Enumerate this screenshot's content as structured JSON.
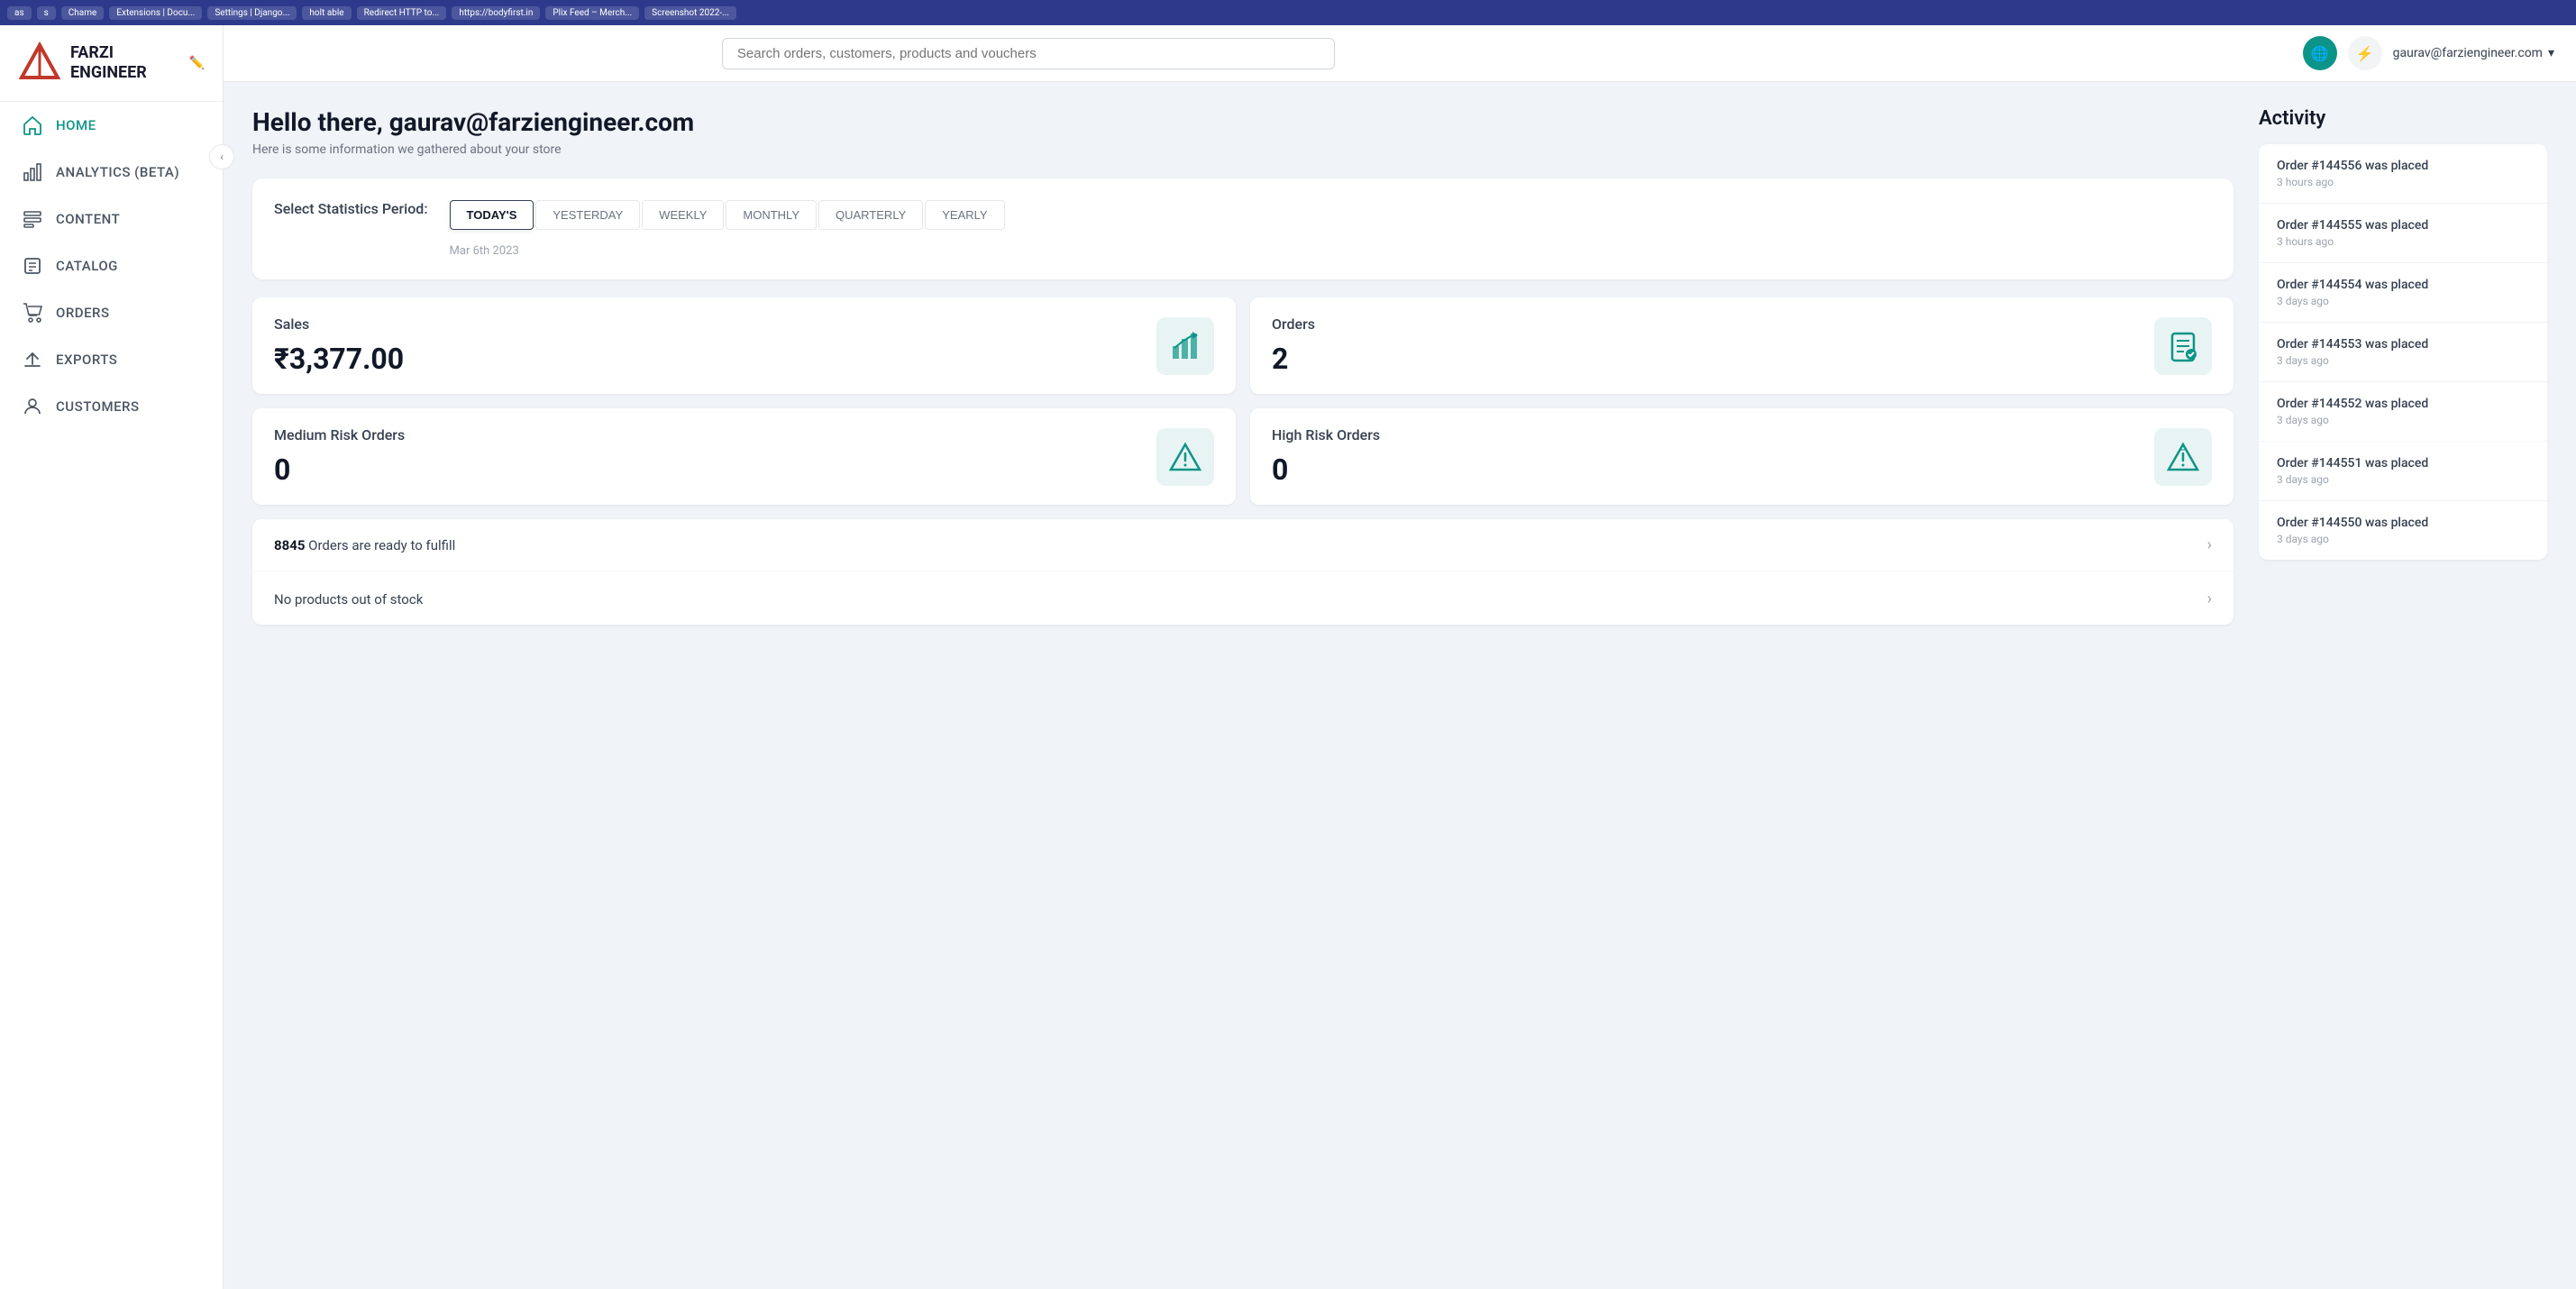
{
  "browser": {
    "tabs": [
      "as",
      "s",
      "Chame",
      "Extensions | Docu...",
      "Settings | Django...",
      "holt able",
      "Redirect HTTP to...",
      "https://bodyfirst.in",
      "Plix Feed – Merch...",
      "Screenshot 2022-..."
    ]
  },
  "sidebar": {
    "logo_line1": "FARZI",
    "logo_line2": "ENGINEER",
    "collapse_label": "‹",
    "nav_items": [
      {
        "key": "home",
        "label": "HOME",
        "active": true
      },
      {
        "key": "analytics",
        "label": "ANALYTICS (BETA)",
        "active": false
      },
      {
        "key": "content",
        "label": "CONTENT",
        "active": false
      },
      {
        "key": "catalog",
        "label": "CATALOG",
        "active": false
      },
      {
        "key": "orders",
        "label": "ORDERS",
        "active": false
      },
      {
        "key": "exports",
        "label": "EXPORTS",
        "active": false
      },
      {
        "key": "customers",
        "label": "CUSTOMERS",
        "active": false
      }
    ]
  },
  "topbar": {
    "search_placeholder": "Search orders, customers, products and vouchers",
    "user_email": "gaurav@farziengineer.com"
  },
  "page": {
    "greeting": "Hello there, gaurav@farziengineer.com",
    "subtext": "Here is some information we gathered about your store"
  },
  "stats": {
    "period_label": "Select Statistics Period:",
    "tabs": [
      "TODAY'S",
      "YESTERDAY",
      "WEEKLY",
      "MONTHLY",
      "QUARTERLY",
      "YEARLY"
    ],
    "active_tab": "TODAY'S",
    "date": "Mar 6th 2023",
    "metrics": [
      {
        "key": "sales",
        "label": "Sales",
        "value": "₹3,377.00",
        "icon": "chart"
      },
      {
        "key": "orders",
        "label": "Orders",
        "value": "2",
        "icon": "orders"
      },
      {
        "key": "medium-risk",
        "label": "Medium Risk Orders",
        "value": "0",
        "icon": "warning"
      },
      {
        "key": "high-risk",
        "label": "High Risk Orders",
        "value": "0",
        "icon": "danger"
      }
    ],
    "info_items": [
      {
        "count": "8845",
        "text": "Orders are ready to fulfill"
      },
      {
        "count": null,
        "text": "No products out of stock"
      }
    ]
  },
  "activity": {
    "title": "Activity",
    "items": [
      {
        "order": "Order #144556 was placed",
        "time": "3 hours ago"
      },
      {
        "order": "Order #144555 was placed",
        "time": "3 hours ago"
      },
      {
        "order": "Order #144554 was placed",
        "time": "3 days ago"
      },
      {
        "order": "Order #144553 was placed",
        "time": "3 days ago"
      },
      {
        "order": "Order #144552 was placed",
        "time": "3 days ago"
      },
      {
        "order": "Order #144551 was placed",
        "time": "3 days ago"
      },
      {
        "order": "Order #144550 was placed",
        "time": "3 days ago"
      }
    ]
  }
}
